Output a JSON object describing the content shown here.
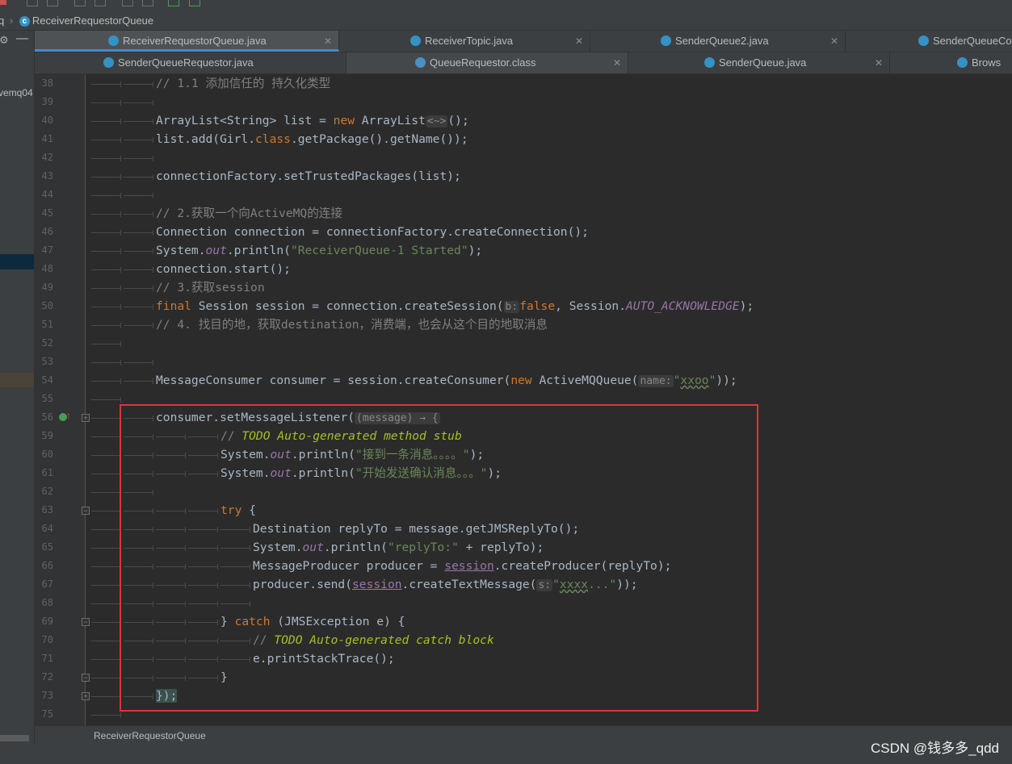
{
  "breadcrumb": {
    "root": "q",
    "file": "ReceiverRequestorQueue"
  },
  "left_panel": {
    "project_fragment": "vemq04"
  },
  "tabs_row1": [
    {
      "label": "ReceiverRequestorQueue.java",
      "active": true
    },
    {
      "label": "ReceiverTopic.java"
    },
    {
      "label": "SenderQueue2.java"
    },
    {
      "label": "SenderQueueCon"
    }
  ],
  "tabs_row2": [
    {
      "label": "SenderQueueRequestor.java"
    },
    {
      "label": "QueueRequestor.class"
    },
    {
      "label": "SenderQueue.java"
    },
    {
      "label": "Brows"
    }
  ],
  "gutter": {
    "line_numbers": [
      "38",
      "39",
      "40",
      "41",
      "42",
      "43",
      "44",
      "45",
      "46",
      "47",
      "48",
      "49",
      "50",
      "51",
      "52",
      "53",
      "54",
      "55",
      "56",
      "59",
      "60",
      "61",
      "62",
      "63",
      "64",
      "65",
      "66",
      "67",
      "68",
      "69",
      "70",
      "71",
      "72",
      "73",
      "75"
    ]
  },
  "code": {
    "l38": "// 1.1 添加信任的 持久化类型",
    "l40a": "ArrayList<String> list = ",
    "l40b": "new",
    "l40c": " ArrayList",
    "l40d": "<~>",
    "l40e": "();",
    "l41a": "list.add(Girl.",
    "l41b": "class",
    "l41c": ".getPackage().getName());",
    "l43": "connectionFactory.setTrustedPackages(list);",
    "l45": "// 2.获取一个向ActiveMQ的连接",
    "l46": "Connection connection = connectionFactory.createConnection();",
    "l47a": "System.",
    "l47b": "out",
    "l47c": ".println(",
    "l47d": "\"ReceiverQueue-1 Started\"",
    "l47e": ");",
    "l48": "connection.start();",
    "l49": "// 3.获取session",
    "l50a": "final",
    "l50b": " Session session = connection.createSession(",
    "l50hint": "b:",
    "l50c": "false",
    "l50d": ", Session.",
    "l50e": "AUTO_ACKNOWLEDGE",
    "l50f": ");",
    "l51": "// 4. 找目的地，获取destination，消费端，也会从这个目的地取消息",
    "l54a": "MessageConsumer consumer = session.createConsumer(",
    "l54b": "new",
    "l54c": " ActiveMQQueue(",
    "l54hint": "name:",
    "l54d": "\"",
    "l54e": "xxoo",
    "l54f": "\"",
    "l54g": "));",
    "l56a": "consumer.setMessageListener(",
    "l56hint": "(message) → {",
    "l59a": "// ",
    "l59b": "TODO Auto-generated method stub",
    "l60a": "System.",
    "l60b": "out",
    "l60c": ".println(",
    "l60d": "\"接到一条消息。。。。\"",
    "l60e": ");",
    "l61a": "System.",
    "l61b": "out",
    "l61c": ".println(",
    "l61d": "\"开始发送确认消息。。。\"",
    "l61e": ");",
    "l63a": "try",
    "l63b": " {",
    "l64": "Destination replyTo = message.getJMSReplyTo();",
    "l65a": "System.",
    "l65b": "out",
    "l65c": ".println(",
    "l65d": "\"replyTo:\"",
    "l65e": " + replyTo);",
    "l66a": "MessageProducer producer = ",
    "l66b": "session",
    "l66c": ".createProducer(replyTo);",
    "l67a": "producer.send(",
    "l67b": "session",
    "l67c": ".createTextMessage(",
    "l67hint": "s:",
    "l67d": "\"",
    "l67e": "xxxx",
    "l67f": "...\"",
    "l67g": "));",
    "l69a": "} ",
    "l69b": "catch",
    "l69c": " (JMSException e) {",
    "l70a": "// ",
    "l70b": "TODO Auto-generated catch block",
    "l71": "e.printStackTrace();",
    "l72": "}",
    "l73": "});"
  },
  "status": {
    "context": "ReceiverRequestorQueue"
  },
  "watermark": "CSDN @钱多多_qdd",
  "colors": {
    "keyword": "#cc7832",
    "string": "#6a8759",
    "comment": "#808080",
    "todo": "#a8c023",
    "static_field": "#9876aa",
    "highlight_box": "#e0323c"
  }
}
